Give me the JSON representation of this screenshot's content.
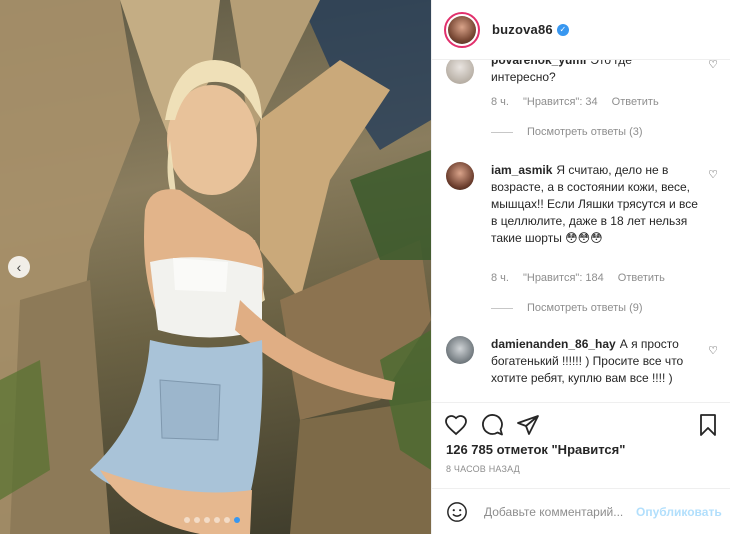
{
  "post": {
    "username": "buzova86",
    "likes_text": "126 785 отметок \"Нравится\"",
    "time_text": "8 ЧАСОВ НАЗАД",
    "carousel": {
      "dot_count": 6,
      "active_index": 5
    }
  },
  "comments": [
    {
      "username": "povarenok_yumi",
      "text": "Это где интересно?",
      "time": "8 ч.",
      "likes": "\"Нравится\": 34",
      "reply_label": "Ответить",
      "view_replies": "Посмотреть ответы (3)"
    },
    {
      "username": "iam_asmik",
      "text": "Я считаю, дело не в возрасте, а в состоянии кожи, весе, мышцах!! Если Ляшки трясутся и все в целлюлите, даже в 18 лет нельзя такие шорты 😳😳😳",
      "time": "8 ч.",
      "likes": "\"Нравится\": 184",
      "reply_label": "Ответить",
      "view_replies": "Посмотреть ответы (9)"
    },
    {
      "username": "damienanden_86_hay",
      "text": "А я просто богатенький !!!!!! ) Просите все что хотите ребят, куплю вам все !!!! )"
    }
  ],
  "add_comment": {
    "placeholder": "Добавьте комментарий...",
    "publish_label": "Опубликовать"
  },
  "colors": {
    "accent": "#3897f0",
    "story_ring": "#e1306c",
    "publish_disabled": "#b2dffc",
    "meta_gray": "#8e8e8e"
  },
  "icons": [
    "chevron-left-icon",
    "verified-icon",
    "heart-icon",
    "comment-icon",
    "share-icon",
    "bookmark-icon",
    "emoji-icon"
  ]
}
